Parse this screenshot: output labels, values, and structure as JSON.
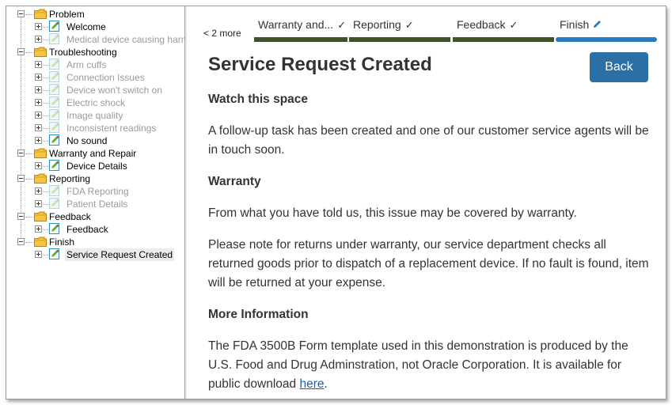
{
  "tree": {
    "items": [
      {
        "label": "Problem",
        "type": "folder",
        "level": 0,
        "state": "expanded"
      },
      {
        "label": "Welcome",
        "type": "page",
        "level": 1,
        "state": "enabled"
      },
      {
        "label": "Medical device causing harm",
        "type": "page",
        "level": 1,
        "state": "disabled"
      },
      {
        "label": "Troubleshooting",
        "type": "folder",
        "level": 0,
        "state": "expanded"
      },
      {
        "label": "Arm cuffs",
        "type": "page",
        "level": 1,
        "state": "disabled"
      },
      {
        "label": "Connection Issues",
        "type": "page",
        "level": 1,
        "state": "disabled"
      },
      {
        "label": "Device won't switch on",
        "type": "page",
        "level": 1,
        "state": "disabled"
      },
      {
        "label": "Electric shock",
        "type": "page",
        "level": 1,
        "state": "disabled"
      },
      {
        "label": "Image quality",
        "type": "page",
        "level": 1,
        "state": "disabled"
      },
      {
        "label": "Inconsistent readings",
        "type": "page",
        "level": 1,
        "state": "disabled"
      },
      {
        "label": "No sound",
        "type": "page",
        "level": 1,
        "state": "enabled"
      },
      {
        "label": "Warranty and Repair",
        "type": "folder",
        "level": 0,
        "state": "expanded"
      },
      {
        "label": "Device Details",
        "type": "page",
        "level": 1,
        "state": "enabled"
      },
      {
        "label": "Reporting",
        "type": "folder",
        "level": 0,
        "state": "expanded"
      },
      {
        "label": "FDA Reporting",
        "type": "page",
        "level": 1,
        "state": "disabled"
      },
      {
        "label": "Patient Details",
        "type": "page",
        "level": 1,
        "state": "disabled"
      },
      {
        "label": "Feedback",
        "type": "folder",
        "level": 0,
        "state": "expanded"
      },
      {
        "label": "Feedback",
        "type": "page",
        "level": 1,
        "state": "enabled"
      },
      {
        "label": "Finish",
        "type": "folder",
        "level": 0,
        "state": "expanded"
      },
      {
        "label": "Service Request Created",
        "type": "page",
        "level": 1,
        "state": "selected"
      }
    ]
  },
  "progress": {
    "more_label": "< 2 more",
    "steps": [
      {
        "label": "Warranty and...",
        "status": "done"
      },
      {
        "label": "Reporting",
        "status": "done"
      },
      {
        "label": "Feedback",
        "status": "done"
      },
      {
        "label": "Finish",
        "status": "current"
      }
    ]
  },
  "page": {
    "title": "Service Request Created",
    "back_label": "Back",
    "heading_watch": "Watch this space",
    "para_followup": "A follow-up task has been created and one of our customer service agents will be in touch soon.",
    "heading_warranty": "Warranty",
    "para_covered": "From what you have told us, this issue may be covered by warranty.",
    "para_returns": "Please note for returns under warranty, our service department checks all returned goods prior to dispatch of a replacement device. If no fault is found, item will be returned at your expense.",
    "heading_more": "More Information",
    "para_fda": "The FDA 3500B Form template used in this demonstration is produced by the U.S. Food and Drug Adminstration, not Oracle Corporation. It is available for public download ",
    "link_here": "here",
    "para_end": "."
  },
  "colors": {
    "step_done": "#3f5229",
    "step_current": "#2a7bbf",
    "back_button": "#2a6fa6",
    "link": "#1a5fb4"
  }
}
